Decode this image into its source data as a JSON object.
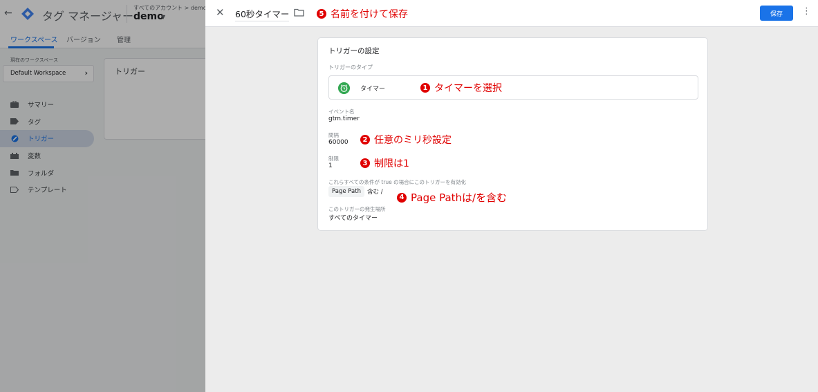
{
  "app": {
    "title": "タグ マネージャー",
    "account_crumb": "すべてのアカウント > demo",
    "container_name": "demo"
  },
  "tabs": [
    {
      "label": "ワークスペース",
      "active": true
    },
    {
      "label": "バージョン",
      "active": false
    },
    {
      "label": "管理",
      "active": false
    }
  ],
  "workspace": {
    "caption": "現在のワークスペース",
    "name": "Default Workspace"
  },
  "sidebar": {
    "items": [
      {
        "label": "サマリー",
        "icon": "briefcase-icon",
        "active": false
      },
      {
        "label": "タグ",
        "icon": "tag-icon",
        "active": false
      },
      {
        "label": "トリガー",
        "icon": "trigger-icon",
        "active": true
      },
      {
        "label": "変数",
        "icon": "variables-icon",
        "active": false
      },
      {
        "label": "フォルダ",
        "icon": "folder-icon",
        "active": false
      },
      {
        "label": "テンプレート",
        "icon": "template-icon",
        "active": false
      }
    ]
  },
  "background_card": {
    "title": "トリガー"
  },
  "editor": {
    "name_value": "60秒タイマー",
    "save_label": "保存",
    "annotation_5": {
      "num": "5",
      "text": "名前を付けて保存"
    }
  },
  "trigger_config": {
    "title": "トリガーの設定",
    "type_caption": "トリガーのタイプ",
    "type_value": "タイマー",
    "event_caption": "イベント名",
    "event_value": "gtm.timer",
    "interval_caption": "間隔",
    "interval_value": "60000",
    "limit_caption": "制限",
    "limit_value": "1",
    "condition_caption": "これらすべての条件が true の場合にこのトリガーを有効化",
    "condition_variable": "Page Path",
    "condition_operator": "含む /",
    "fires_on_caption": "このトリガーの発生場所",
    "fires_on_value": "すべてのタイマー"
  },
  "annotations": [
    {
      "num": "1",
      "text": "タイマーを選択"
    },
    {
      "num": "2",
      "text": "任意のミリ秒設定"
    },
    {
      "num": "3",
      "text": "制限は1"
    },
    {
      "num": "4",
      "text": "Page Pathは/を含む"
    }
  ],
  "colors": {
    "accent": "#1a73e8",
    "annotation": "#e00000",
    "timer_icon": "#34a853"
  }
}
